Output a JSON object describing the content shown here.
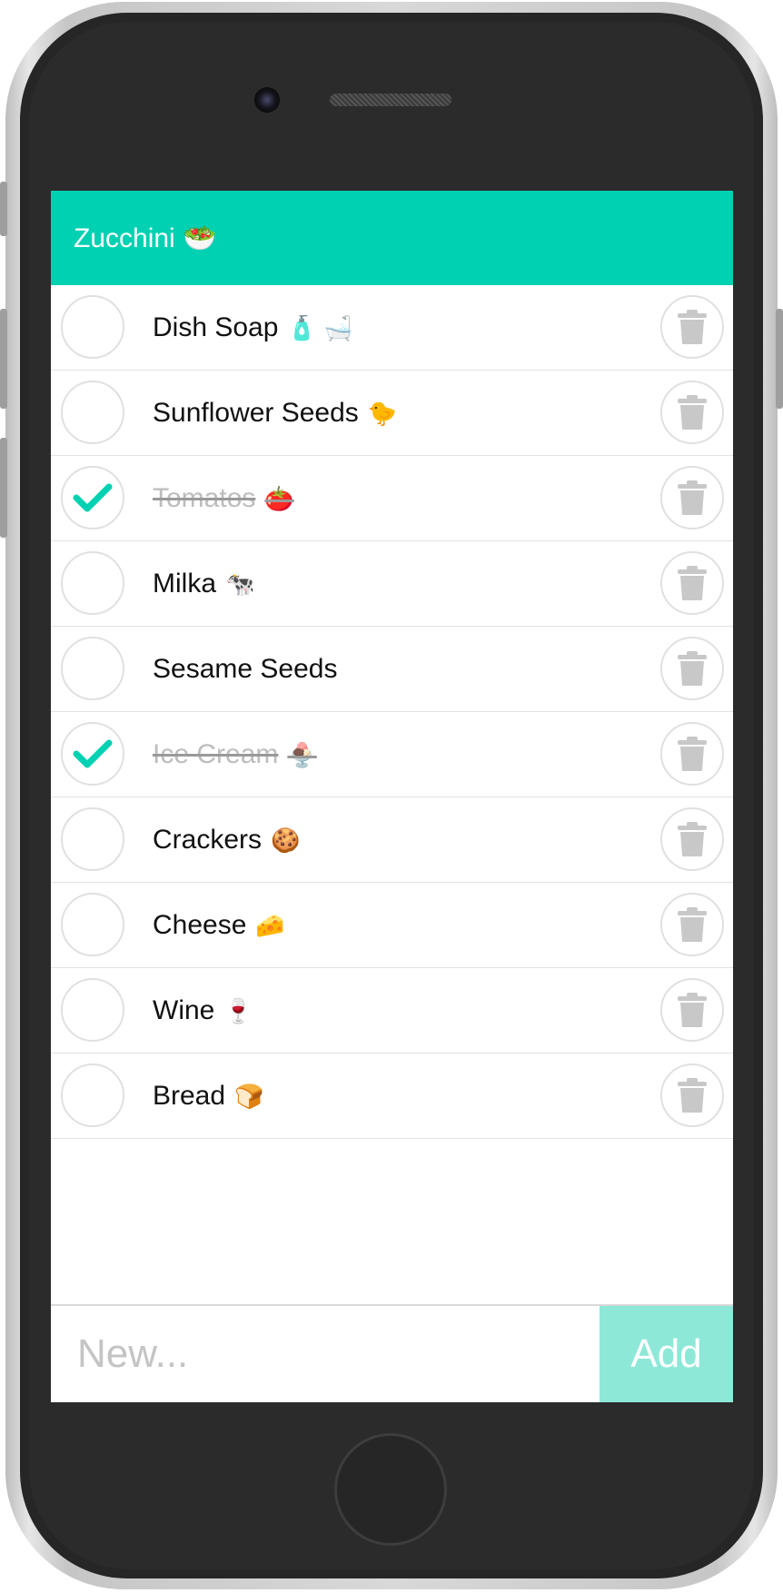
{
  "app": {
    "title": "Zucchini",
    "title_emoji": "🥗"
  },
  "colors": {
    "accent": "#00d1b2",
    "add_button": "#8ee8d8",
    "done_text": "#bdbdbd",
    "circle_border": "#e0e0e0",
    "trash_icon": "#c8c8c8"
  },
  "items": [
    {
      "label": "Dish Soap",
      "emoji": "🧴 🛁",
      "done": false
    },
    {
      "label": "Sunflower Seeds",
      "emoji": "🐤",
      "done": false
    },
    {
      "label": "Tomatos",
      "emoji": "🍅",
      "done": true
    },
    {
      "label": "Milka",
      "emoji": "🐄",
      "done": false
    },
    {
      "label": "Sesame Seeds",
      "emoji": "",
      "done": false
    },
    {
      "label": "Ice Cream",
      "emoji": "🍨",
      "done": true
    },
    {
      "label": "Crackers",
      "emoji": "🍪",
      "done": false
    },
    {
      "label": "Cheese",
      "emoji": "🧀",
      "done": false
    },
    {
      "label": "Wine",
      "emoji": "🍷",
      "done": false
    },
    {
      "label": "Bread",
      "emoji": "🍞",
      "done": false
    }
  ],
  "new_item": {
    "placeholder": "New...",
    "value": ""
  },
  "add_button": {
    "label": "Add"
  }
}
